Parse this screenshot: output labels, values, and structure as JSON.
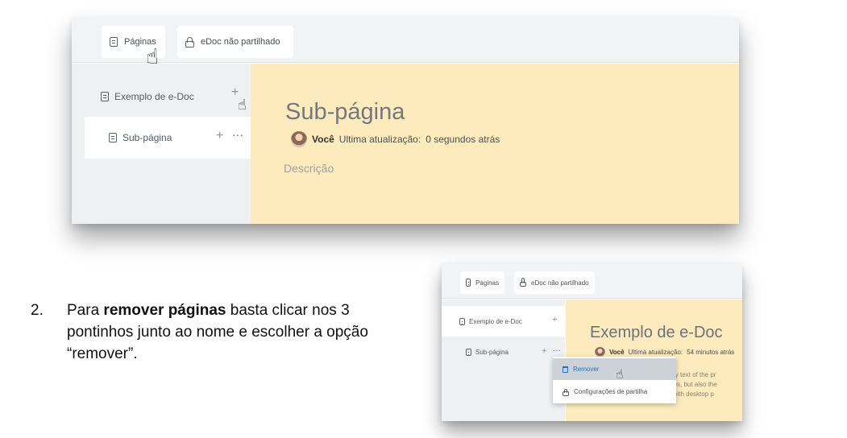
{
  "shot1": {
    "toolbar": {
      "pages_label": "Páginas",
      "share_label": "eDoc não partilhado"
    },
    "sidebar": {
      "items": [
        {
          "label": "Exemplo de e-Doc"
        },
        {
          "label": "Sub-página"
        }
      ]
    },
    "page": {
      "title": "Sub-página",
      "author": "Você",
      "updated_label": "Ultima atualização:",
      "updated_value": "0 segundos atrás",
      "description_placeholder": "Descrição"
    }
  },
  "instructions": {
    "number": "2.",
    "text_before": "Para ",
    "text_bold": "remover páginas",
    "text_after": " basta clicar nos 3 pontinhos junto ao nome e escolher a opção “remover”."
  },
  "shot2": {
    "toolbar": {
      "pages_label": "Páginas",
      "share_label": "eDoc não partilhado"
    },
    "sidebar": {
      "items": [
        {
          "label": "Exemplo de e-Doc"
        },
        {
          "label": "Sub-página"
        }
      ]
    },
    "page": {
      "title": "Exemplo de e-Doc",
      "author": "Você",
      "updated_label": "Ultima atualização:",
      "updated_value": "54 minutos atrás",
      "body_lines": [
        "ummy text of the pr",
        "nturies, but also the",
        "ntly with desktop p"
      ]
    },
    "context_menu": {
      "items": [
        {
          "label": "Remover"
        },
        {
          "label": "Configurações de partilha"
        }
      ]
    }
  },
  "icons": {
    "doc": "document-icon",
    "lock": "lock-icon",
    "plus": "+",
    "dots": "···",
    "hand": "☝",
    "trash": "trash-icon"
  },
  "colors": {
    "page_bg": "#feebbd",
    "sidebar_bg": "#eef0f2",
    "toolbar_bg": "#f2f3f4",
    "menu_highlight": "#cdd2d8",
    "accent_blue": "#2a6fba"
  }
}
